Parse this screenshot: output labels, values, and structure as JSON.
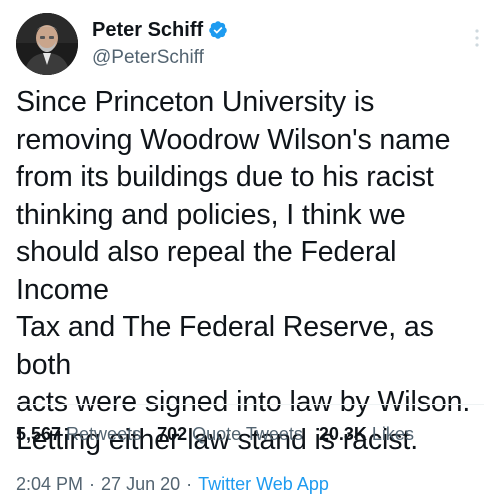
{
  "author": {
    "name": "Peter Schiff",
    "handle": "@PeterSchiff",
    "verified": true,
    "avatar_icon": "profile-photo"
  },
  "tweet": {
    "text": "Since Princeton University is\nremoving Woodrow Wilson's name\nfrom its buildings due to his racist\nthinking and policies, I think we\nshould also repeal the Federal Income\nTax and The Federal Reserve, as both\nacts were signed into law by Wilson.\nLetting either law stand is racist.",
    "time": "2:04 PM",
    "separator": "·",
    "date": "27 Jun 20",
    "source": "Twitter Web App"
  },
  "stats": {
    "retweets_count": "5,567",
    "retweets_label": "Retweets",
    "quotes_count": "702",
    "quotes_label": "Quote Tweets",
    "likes_count": "20.3K",
    "likes_label": "Likes"
  },
  "colors": {
    "text": "#0f1419",
    "secondary": "#536471",
    "accent": "#1d9bf0"
  }
}
